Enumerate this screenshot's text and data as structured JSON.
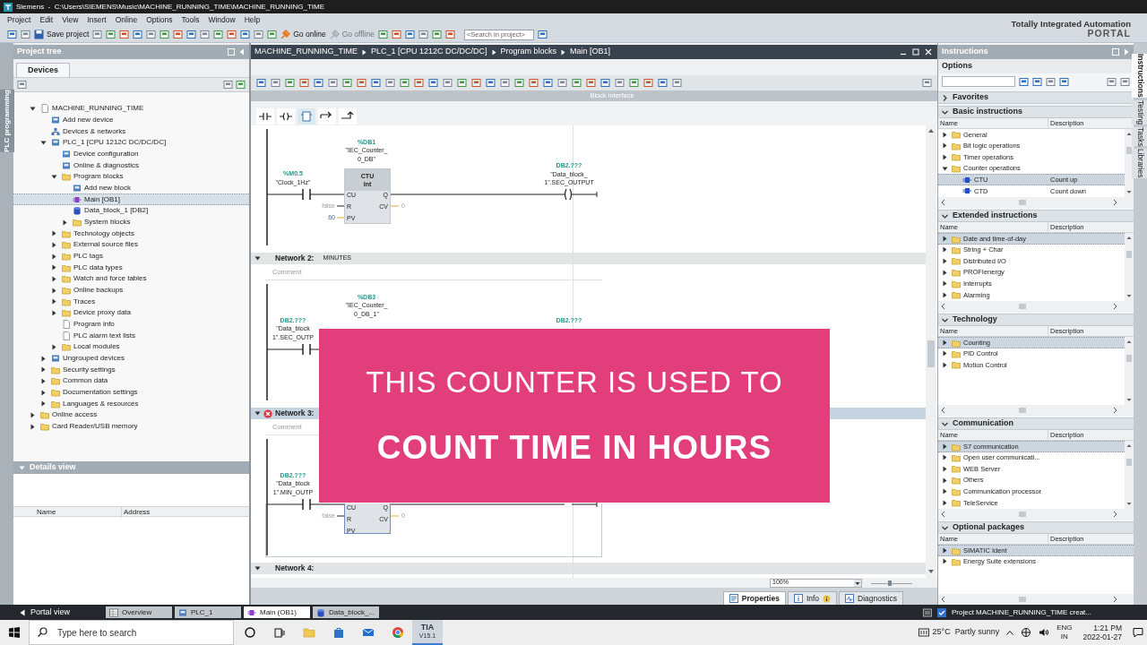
{
  "title_bar": {
    "title": "Siemens  -  C:\\Users\\SIEMENS\\Music\\MACHINE_RUNNING_TIME\\MACHINE_RUNNING_TIME"
  },
  "menu": [
    "Project",
    "Edit",
    "View",
    "Insert",
    "Online",
    "Options",
    "Tools",
    "Window",
    "Help"
  ],
  "toolbar": {
    "buttons": [
      {
        "label": "Save project",
        "kind": "save",
        "disabled": false
      },
      {
        "label": "Go online",
        "kind": "online",
        "disabled": false
      },
      {
        "label": "Go offline",
        "kind": "offline",
        "disabled": true
      }
    ],
    "search_placeholder": "<Search in project>"
  },
  "brand": {
    "line1": "Totally Integrated Automation",
    "line2": "PORTAL"
  },
  "project_tree": {
    "title": "Project tree",
    "side_tab": "PLC programming",
    "tab": "Devices",
    "items": [
      {
        "label": "MACHINE_RUNNING_TIME",
        "kind": "document",
        "expanded": true,
        "selected": false,
        "children": [
          {
            "label": "Add new device",
            "kind": "device",
            "selected": false
          },
          {
            "label": "Devices & networks",
            "kind": "network",
            "selected": false
          },
          {
            "label": "PLC_1 [CPU 1212C DC/DC/DC]",
            "kind": "device",
            "expanded": true,
            "selected": false,
            "children": [
              {
                "label": "Device configuration",
                "kind": "device",
                "selected": false
              },
              {
                "label": "Online & diagnostics",
                "kind": "device",
                "selected": false
              },
              {
                "label": "Program blocks",
                "kind": "folder",
                "expanded": true,
                "selected": false,
                "children": [
                  {
                    "label": "Add new block",
                    "kind": "device",
                    "selected": false
                  },
                  {
                    "label": "Main [OB1]",
                    "kind": "block",
                    "selected": true
                  },
                  {
                    "label": "Data_block_1 [DB2]",
                    "kind": "database",
                    "selected": false
                  },
                  {
                    "label": "System blocks",
                    "kind": "folder",
                    "expanded": false,
                    "selected": false
                  }
                ]
              },
              {
                "label": "Technology objects",
                "kind": "folder",
                "expanded": false,
                "selected": false
              },
              {
                "label": "External source files",
                "kind": "folder",
                "expanded": false,
                "selected": false
              },
              {
                "label": "PLC tags",
                "kind": "folder",
                "expanded": false,
                "selected": false
              },
              {
                "label": "PLC data types",
                "kind": "folder",
                "expanded": false,
                "selected": false
              },
              {
                "label": "Watch and force tables",
                "kind": "folder",
                "expanded": false,
                "selected": false
              },
              {
                "label": "Online backups",
                "kind": "folder",
                "expanded": false,
                "selected": false
              },
              {
                "label": "Traces",
                "kind": "folder",
                "expanded": false,
                "selected": false
              },
              {
                "label": "Device proxy data",
                "kind": "folder",
                "expanded": false,
                "selected": false
              },
              {
                "label": "Program info",
                "kind": "document",
                "selected": false
              },
              {
                "label": "PLC alarm text lists",
                "kind": "document",
                "selected": false
              },
              {
                "label": "Local modules",
                "kind": "folder",
                "expanded": false,
                "selected": false
              }
            ]
          },
          {
            "label": "Ungrouped devices",
            "kind": "device",
            "expanded": false,
            "selected": false
          },
          {
            "label": "Security settings",
            "kind": "folder",
            "expanded": false,
            "selected": false
          },
          {
            "label": "Common data",
            "kind": "folder",
            "expanded": false,
            "selected": false
          },
          {
            "label": "Documentation settings",
            "kind": "folder",
            "expanded": false,
            "selected": false
          },
          {
            "label": "Languages & resources",
            "kind": "folder",
            "expanded": false,
            "selected": false
          }
        ]
      },
      {
        "label": "Online access",
        "kind": "folder",
        "expanded": false,
        "selected": false
      },
      {
        "label": "Card Reader/USB memory",
        "kind": "folder",
        "expanded": false,
        "selected": false
      }
    ]
  },
  "details_view": {
    "title": "Details view",
    "columns": [
      "Name",
      "Address"
    ]
  },
  "editor": {
    "breadcrumb": [
      "MACHINE_RUNNING_TIME",
      "PLC_1 [CPU 1212C DC/DC/DC]",
      "Program blocks",
      "Main [OB1]"
    ],
    "block_interface": "Block interface",
    "networks": [
      {
        "selected": false,
        "error": false,
        "rung": {
          "contact": {
            "address": "%M0.5",
            "tag": [
              "\"Clock_1Hz\""
            ]
          },
          "block": {
            "instance": [
              "%DB1",
              "\"IEC_Counter_",
              "0_DB\""
            ],
            "type": [
              "CTU",
              "Int"
            ],
            "inputs": [
              {
                "pin": "CU"
              },
              {
                "pin": "R",
                "value": "false",
                "kind": "default"
              },
              {
                "pin": "PV",
                "value": "60",
                "kind": "constant"
              }
            ],
            "outputs": [
              {
                "pin": "Q"
              },
              {
                "pin": "CV",
                "value": "0",
                "kind": "default"
              }
            ]
          },
          "coil": {
            "address": "DB2.???",
            "tag": [
              "\"Data_block_",
              "1\".SEC_OUTPUT"
            ]
          }
        }
      },
      {
        "label": "Network 2:",
        "title": "MINUTES",
        "comment": "Comment",
        "selected": false,
        "error": false,
        "rung": {
          "contact": {
            "address": "DB2.???",
            "tag": [
              "\"Data_block",
              "1\".SEC_OUTP"
            ]
          },
          "block": {
            "instance": [
              "%DB3",
              "\"IEC_Counter_",
              "0_DB_1\""
            ]
          },
          "coil": {
            "address": "DB2.???"
          }
        }
      },
      {
        "label": "Network 3:",
        "comment": "Comment",
        "selected": true,
        "error": true,
        "rung": {
          "contact": {
            "address": "DB2.???",
            "tag": [
              "\"Data_block",
              "1\".MIN_OUTP"
            ]
          },
          "block": {
            "inputs": [
              {
                "pin": "CU"
              },
              {
                "pin": "R",
                "value": "false",
                "kind": "default"
              },
              {
                "pin": "PV"
              }
            ],
            "outputs": [
              {
                "pin": "Q"
              },
              {
                "pin": "CV",
                "value": "0",
                "kind": "default"
              }
            ]
          }
        }
      },
      {
        "label": "Network 4:",
        "selected": false,
        "error": false
      }
    ],
    "zoom": "100%",
    "zoom_slider": {
      "level": 0.45
    },
    "inspector_tabs": [
      {
        "label": "Properties",
        "selected": true
      },
      {
        "label": "Info",
        "selected": false
      },
      {
        "label": "Diagnostics",
        "selected": false
      }
    ]
  },
  "caption": {
    "line1": "THIS COUNTER IS USED TO",
    "line2": "COUNT TIME IN HOURS"
  },
  "instructions": {
    "title": "Instructions",
    "options": "Options",
    "sections": [
      {
        "title": "Favorites",
        "expanded": false
      },
      {
        "title": "Basic instructions",
        "expanded": true,
        "columns": [
          "Name",
          "Description"
        ],
        "rows": [
          {
            "name": "General",
            "kind": "folder",
            "expanded": false,
            "selected": false
          },
          {
            "name": "Bit logic operations",
            "kind": "folder",
            "expanded": false,
            "selected": false
          },
          {
            "name": "Timer operations",
            "kind": "folder",
            "expanded": false,
            "selected": false
          },
          {
            "name": "Counter operations",
            "kind": "folder",
            "expanded": true,
            "selected": false,
            "children": [
              {
                "name": "CTU",
                "description": "Count up",
                "kind": "function",
                "selected": true
              },
              {
                "name": "CTD",
                "description": "Count down",
                "kind": "function",
                "selected": false
              }
            ]
          }
        ]
      },
      {
        "title": "Extended instructions",
        "expanded": true,
        "columns": [
          "Name",
          "Description"
        ],
        "rows": [
          {
            "name": "Date and time-of-day",
            "kind": "folder",
            "expanded": false,
            "selected": true
          },
          {
            "name": "String + Char",
            "kind": "folder",
            "expanded": false,
            "selected": false
          },
          {
            "name": "Distributed I/O",
            "kind": "folder",
            "expanded": false,
            "selected": false
          },
          {
            "name": "PROFIenergy",
            "kind": "folder",
            "expanded": false,
            "selected": false
          },
          {
            "name": "Interrupts",
            "kind": "folder",
            "expanded": false,
            "selected": false
          },
          {
            "name": "Alarming",
            "kind": "folder",
            "expanded": false,
            "selected": false
          }
        ]
      },
      {
        "title": "Technology",
        "expanded": true,
        "columns": [
          "Name",
          "Description"
        ],
        "rows": [
          {
            "name": "Counting",
            "kind": "folder",
            "expanded": false,
            "selected": true
          },
          {
            "name": "PID Control",
            "kind": "folder",
            "expanded": false,
            "selected": false
          },
          {
            "name": "Motion Control",
            "kind": "folder",
            "expanded": false,
            "selected": false
          }
        ]
      },
      {
        "title": "Communication",
        "expanded": true,
        "columns": [
          "Name",
          "Description"
        ],
        "rows": [
          {
            "name": "S7 communication",
            "kind": "folder",
            "expanded": false,
            "selected": true
          },
          {
            "name": "Open user communicati...",
            "kind": "folder",
            "expanded": false,
            "selected": false
          },
          {
            "name": "WEB Server",
            "kind": "folder",
            "expanded": false,
            "selected": false
          },
          {
            "name": "Others",
            "kind": "folder",
            "expanded": false,
            "selected": false
          },
          {
            "name": "Communication processor",
            "kind": "folder",
            "expanded": false,
            "selected": false
          },
          {
            "name": "TeleService",
            "kind": "folder",
            "expanded": false,
            "selected": false
          }
        ]
      },
      {
        "title": "Optional packages",
        "expanded": true,
        "columns": [
          "Name",
          "Description"
        ],
        "rows": [
          {
            "name": "SIMATIC Ident",
            "kind": "folder",
            "expanded": false,
            "selected": true
          },
          {
            "name": "Energy Suite extensions",
            "kind": "folder",
            "expanded": false,
            "selected": false
          }
        ]
      }
    ]
  },
  "side_tabs": [
    {
      "label": "Instructions",
      "selected": true
    },
    {
      "label": "Testing",
      "selected": false
    },
    {
      "label": "Tasks",
      "selected": false
    },
    {
      "label": "Libraries",
      "selected": false
    }
  ],
  "portal_bar": {
    "portal_view": "Portal view",
    "tabs": [
      {
        "label": "Overview",
        "kind": "overview",
        "selected": false
      },
      {
        "label": "PLC_1",
        "kind": "device",
        "selected": false
      },
      {
        "label": "Main (OB1)",
        "kind": "block",
        "selected": true
      },
      {
        "label": "Data_block_...",
        "kind": "database",
        "selected": false
      }
    ],
    "status": "Project MACHINE_RUNNING_TIME creat..."
  },
  "taskbar": {
    "search_placeholder": "Type here to search",
    "app": {
      "label": "TIA",
      "version": "V15.1",
      "selected": true
    },
    "weather": "25°C  Partly sunny",
    "language": [
      "ENG",
      "IN"
    ],
    "time": "1:21 PM",
    "date": "2022-01-27"
  }
}
